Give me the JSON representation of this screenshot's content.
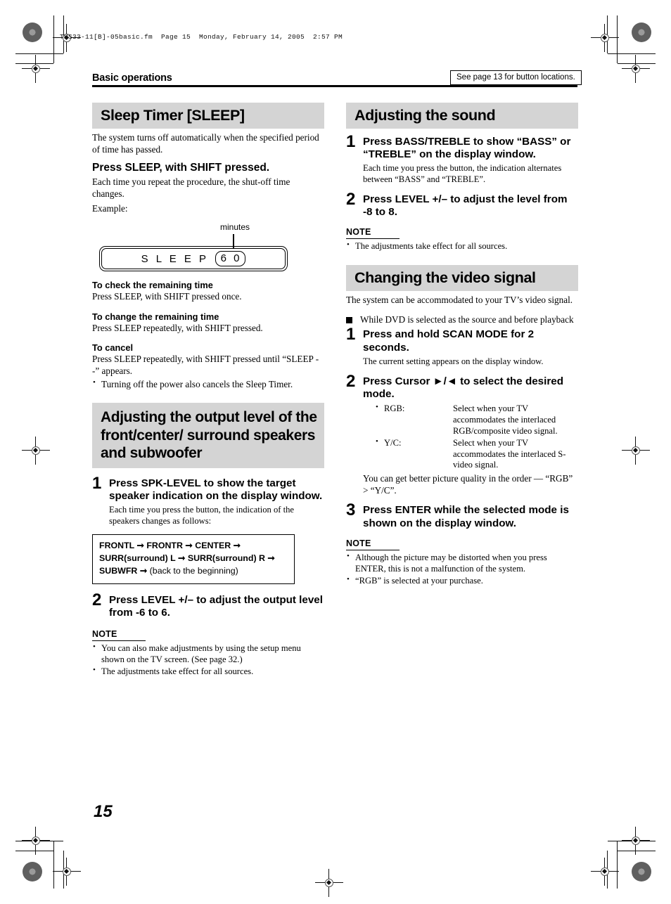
{
  "printer_header": "THS33-11[B]-05basic.fm  Page 15  Monday, February 14, 2005  2:57 PM",
  "running_head": {
    "title": "Basic operations",
    "button_locations_note": "See page 13 for button locations."
  },
  "page_number": "15",
  "left_column": {
    "sleep_timer": {
      "heading": "Sleep Timer [SLEEP]",
      "intro": "The system turns off automatically when the specified period of time has passed.",
      "action_title": "Press SLEEP, with SHIFT pressed.",
      "action_body": "Each time you repeat the procedure, the shut-off time changes.",
      "example_label": "Example:",
      "display": {
        "callout": "minutes",
        "text": "S L E E P",
        "value": "6 0"
      },
      "subsections": [
        {
          "title": "To check the remaining time",
          "body": "Press SLEEP, with SHIFT pressed once."
        },
        {
          "title": "To change the remaining time",
          "body": "Press SLEEP repeatedly, with SHIFT pressed."
        },
        {
          "title": "To cancel",
          "body": "Press SLEEP repeatedly, with SHIFT pressed until “SLEEP - -” appears.",
          "bullets": [
            "Turning off the power also cancels the Sleep Timer."
          ]
        }
      ]
    },
    "output_level": {
      "heading": "Adjusting the output level of the front/center/ surround speakers and subwoofer",
      "steps": [
        {
          "num": "1",
          "title": "Press SPK-LEVEL to show the target speaker indication on the display window.",
          "body": "Each time you press the button, the indication of the speakers changes as follows:"
        },
        {
          "num": "2",
          "title": "Press LEVEL +/– to adjust the output level from -6 to 6.",
          "body": ""
        }
      ],
      "sequence_box": {
        "line1_a": "FRONTL",
        "line1_b": "FRONTR",
        "line1_c": "CENTER",
        "line2_a": "SURR(surround) L",
        "line2_b": "SURR(surround) R",
        "line3_a": "SUBWFR",
        "line3_b": "(back to the beginning)"
      },
      "note": {
        "label": "NOTE",
        "bullets": [
          "You can also make adjustments by using the setup menu shown on the TV screen. (See page 32.)",
          "The adjustments take effect for all sources."
        ]
      }
    }
  },
  "right_column": {
    "adjusting_sound": {
      "heading": "Adjusting the sound",
      "steps": [
        {
          "num": "1",
          "title": "Press BASS/TREBLE to show “BASS” or “TREBLE” on the display window.",
          "body": "Each time you press the button, the indication alternates between “BASS” and “TREBLE”."
        },
        {
          "num": "2",
          "title": "Press LEVEL +/– to adjust the level from -8 to 8.",
          "body": ""
        }
      ],
      "note": {
        "label": "NOTE",
        "bullets": [
          "The adjustments take effect for all sources."
        ]
      }
    },
    "video_signal": {
      "heading": "Changing the video signal",
      "intro": "The system can be accommodated to your TV’s video signal.",
      "condition": "While DVD is selected as the source and before playback",
      "steps": [
        {
          "num": "1",
          "title": "Press and hold SCAN MODE for 2 seconds.",
          "body": "The current setting appears on the display window."
        },
        {
          "num": "2",
          "title": "Press Cursor ►/◄ to select the desired mode.",
          "body": ""
        },
        {
          "num": "3",
          "title": "Press ENTER while the selected mode is shown on the display window.",
          "body": ""
        }
      ],
      "modes": [
        {
          "term": "RGB:",
          "desc": "Select when your TV accommodates the interlaced RGB/composite video signal."
        },
        {
          "term": "Y/C:",
          "desc": "Select when your TV accommodates the interlaced S-video signal."
        }
      ],
      "quality_note": "You can get better picture quality in the order — “RGB” > “Y/C”.",
      "note": {
        "label": "NOTE",
        "bullets": [
          "Although the picture may be distorted when you press ENTER, this is not a malfunction of the system.",
          "“RGB” is selected at your purchase."
        ]
      }
    }
  }
}
